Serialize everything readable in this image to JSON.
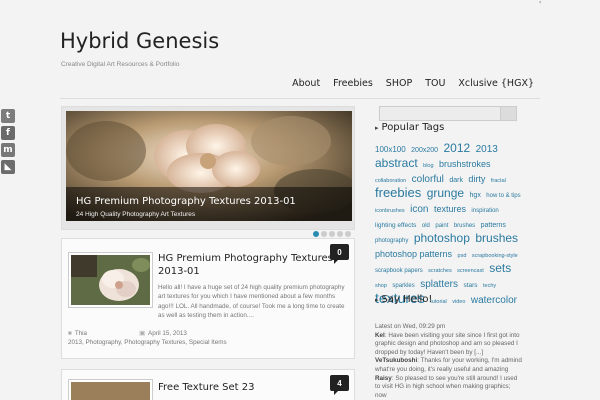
{
  "site": {
    "title": "Hybrid Genesis",
    "tagline": "Creative Digital Art Resources & Portfolio",
    "top_mark": "'"
  },
  "nav": [
    "About",
    "Freebies",
    "SHOP",
    "TOU",
    "Xclusive {HGX}"
  ],
  "social": [
    {
      "icon": "twitter-icon",
      "glyph": "t",
      "color": "#7c7c7c"
    },
    {
      "icon": "facebook-icon",
      "glyph": "f",
      "color": "#6a6a6a"
    },
    {
      "icon": "myspace-icon",
      "glyph": "m",
      "color": "#777777"
    },
    {
      "icon": "rss-icon",
      "glyph": "◣",
      "color": "#6c6c6c"
    }
  ],
  "slider": {
    "title": "HG Premium Photography Textures 2013-01",
    "subtitle": "24 High Quality Photography Art Textures",
    "active_index": 0,
    "count": 5
  },
  "posts": [
    {
      "title": "HG Premium Photography Textures 2013-01",
      "comments": "0",
      "excerpt": "Hello all! I have a huge set of 24 high quality premium photography art textures for you which I have mentioned about a few months ago!!! LOL. All handmade, of course! Took me a long time to create as well as testing them in action....",
      "author": "Thia",
      "date": "April 15, 2013",
      "categories": "2013, Photography, Photography Textures, Special Items"
    },
    {
      "title": "Free Texture Set 23",
      "comments": "4"
    }
  ],
  "sidebar": {
    "popular_tags_title": "Popular Tags",
    "tags": [
      {
        "text": "100x100",
        "size": 8
      },
      {
        "text": "200x200",
        "size": 7
      },
      {
        "text": "2012",
        "size": 12
      },
      {
        "text": "2013",
        "size": 10
      },
      {
        "text": "abstract",
        "size": 12
      },
      {
        "text": "blog",
        "size": 5.5
      },
      {
        "text": "brushstrokes",
        "size": 9
      },
      {
        "text": "collaboration",
        "size": 5.5
      },
      {
        "text": "colorful",
        "size": 10
      },
      {
        "text": "dark",
        "size": 7
      },
      {
        "text": "dirty",
        "size": 9
      },
      {
        "text": "fractal",
        "size": 5.5
      },
      {
        "text": "freebies",
        "size": 13
      },
      {
        "text": "grunge",
        "size": 12
      },
      {
        "text": "hgx",
        "size": 7
      },
      {
        "text": "how to & tips",
        "size": 6
      },
      {
        "text": "iconbrushes",
        "size": 5.5
      },
      {
        "text": "icon",
        "size": 10
      },
      {
        "text": "textures",
        "size": 9
      },
      {
        "text": "inspiration",
        "size": 6
      },
      {
        "text": "lighting effects",
        "size": 6.5
      },
      {
        "text": "old",
        "size": 6
      },
      {
        "text": "paint",
        "size": 6
      },
      {
        "text": "brushes",
        "size": 6
      },
      {
        "text": "patterns",
        "size": 7
      },
      {
        "text": "photography",
        "size": 6
      },
      {
        "text": "photoshop",
        "size": 12
      },
      {
        "text": "brushes",
        "size": 12
      },
      {
        "text": "photoshop patterns",
        "size": 9
      },
      {
        "text": "psd",
        "size": 5.5
      },
      {
        "text": "scrapbooking-style",
        "size": 5.5
      },
      {
        "text": "scrapbook papers",
        "size": 6
      },
      {
        "text": "scratches",
        "size": 5.5
      },
      {
        "text": "screencast",
        "size": 5.5
      },
      {
        "text": "sets",
        "size": 12
      },
      {
        "text": "shop",
        "size": 5.5
      },
      {
        "text": "sparkles",
        "size": 6
      },
      {
        "text": "splatters",
        "size": 10
      },
      {
        "text": "stars",
        "size": 6.5
      },
      {
        "text": "techy",
        "size": 5.5
      },
      {
        "text": "textures",
        "size": 14
      },
      {
        "text": "tutorial",
        "size": 5.5
      },
      {
        "text": "video",
        "size": 5.5
      },
      {
        "text": "watercolor",
        "size": 10
      }
    ],
    "say_hello_title": "Say Hello!",
    "latest": "Latest on Wed, 09:29 pm",
    "messages": [
      {
        "name": "Kel",
        "text": "Have been visiting your site since I first got into graphic design and photoshop and am so pleased I dropped by today! Haven't been by [...]"
      },
      {
        "name": "VeTsukuboshi",
        "text": "Thanks for your working, I'm admind what're you doing, it's really useful and amazing"
      },
      {
        "name": "Raisy",
        "text": "So pleased to see you're still around! I used to visit HG in high school when making graphics; now"
      }
    ]
  }
}
